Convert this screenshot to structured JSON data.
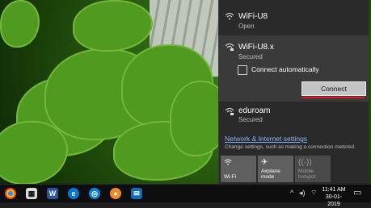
{
  "networks": [
    {
      "name": "WiFi-U8",
      "status": "Open",
      "icon": "wifi-icon"
    },
    {
      "name": "WiFi-U8.x",
      "status": "Secured",
      "icon": "wifi-secured-icon"
    },
    {
      "name": "eduroam",
      "status": "Secured",
      "icon": "wifi-secured-icon"
    }
  ],
  "connect_auto_label": "Connect automatically",
  "connect_auto_checked": false,
  "connect_label": "Connect",
  "settings": {
    "link": "Network & Internet settings",
    "desc": "Change settings, such as making a connection metered."
  },
  "quick_actions": [
    {
      "label": "Wi-Fi",
      "icon": "wifi-icon",
      "enabled": true
    },
    {
      "label": "Airplane mode",
      "icon": "airplane-icon",
      "enabled": true
    },
    {
      "label": "Mobile hotspot",
      "icon": "hotspot-icon",
      "enabled": false
    }
  ],
  "taskbar": {
    "apps": [
      "chrome-icon",
      "calculator-icon",
      "word-icon",
      "edge-icon",
      "store-icon",
      "app-orange-icon",
      "mail-icon"
    ],
    "tray_icons": [
      "chevron-up-icon",
      "volume-icon",
      "network-icon",
      "language-icon"
    ],
    "time": "11:41 AM",
    "date": "30-01-2019"
  },
  "colors": {
    "accent_red": "#e01b24",
    "panel_bg": "#2a2a2a",
    "link": "#8ab4f8"
  }
}
